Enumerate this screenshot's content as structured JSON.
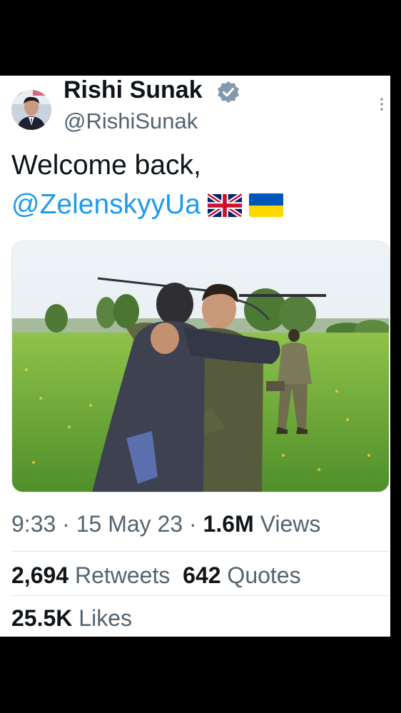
{
  "tweet": {
    "display_name": "Rishi Sunak",
    "handle": "@RishiSunak",
    "text_line1": "Welcome back,",
    "mention": "@ZelenskyyUa",
    "flags": [
      "gb-flag",
      "ua-flag"
    ],
    "time": "9:33",
    "date": "15 May 23",
    "views_count": "1.6M",
    "views_label": "Views",
    "retweets_count": "2,694",
    "retweets_label": "Retweets",
    "quotes_count": "642",
    "quotes_label": "Quotes",
    "likes_count": "25.5K",
    "likes_label": "Likes",
    "separator": "·"
  },
  "colors": {
    "accent": "#1d9bf0",
    "text_primary": "#0f1419",
    "text_secondary": "#536471",
    "background": "#ffffff",
    "frame": "#000000"
  }
}
